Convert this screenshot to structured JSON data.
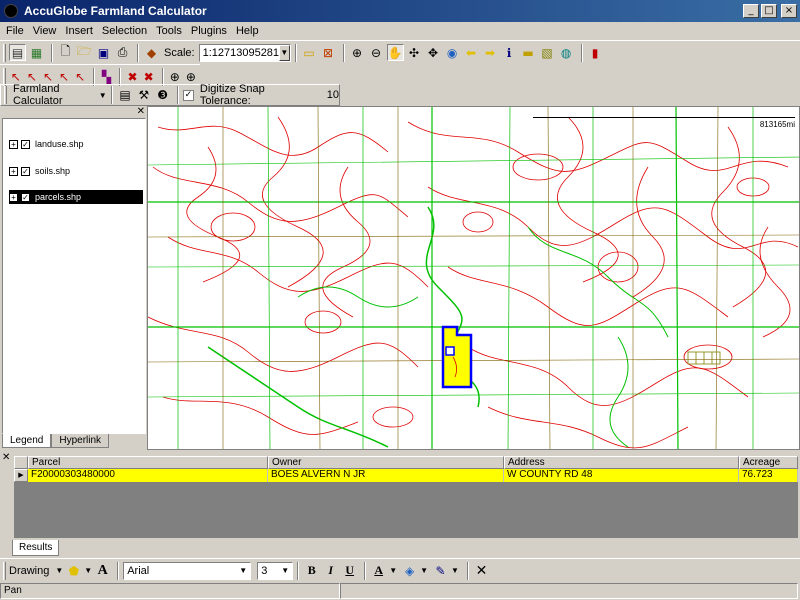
{
  "window": {
    "title": "AccuGlobe Farmland Calculator"
  },
  "menu": [
    "File",
    "View",
    "Insert",
    "Selection",
    "Tools",
    "Plugins",
    "Help"
  ],
  "toolbar1": {
    "scale_label": "Scale:",
    "scale_value": "1:12713095281"
  },
  "plugin_toolbar": {
    "name": "Farmland Calculator",
    "snap_label": "Digitize Snap Tolerance:",
    "snap_value": "10"
  },
  "legend": {
    "layers": [
      {
        "name": "landuse.shp",
        "selected": false
      },
      {
        "name": "soils.shp",
        "selected": false
      },
      {
        "name": "parcels.shp",
        "selected": true
      }
    ],
    "tabs": [
      "Legend",
      "Hyperlink"
    ]
  },
  "map": {
    "scale_text": "813165mi",
    "selected_fill": "#ffff00",
    "selected_stroke": "#0000ff",
    "soil_color": "#e00000",
    "landuse_color": "#00c000"
  },
  "results": {
    "columns": [
      "Parcel",
      "Owner",
      "Address",
      "Acreage"
    ],
    "rows": [
      {
        "Parcel": "F20000303480000",
        "Owner": "BOES ALVERN N JR",
        "Address": "W COUNTY RD 48",
        "Acreage": "76.723"
      }
    ],
    "tab": "Results"
  },
  "drawbar": {
    "label": "Drawing",
    "font": "Arial",
    "size": "3"
  },
  "status": {
    "text": "Pan"
  }
}
